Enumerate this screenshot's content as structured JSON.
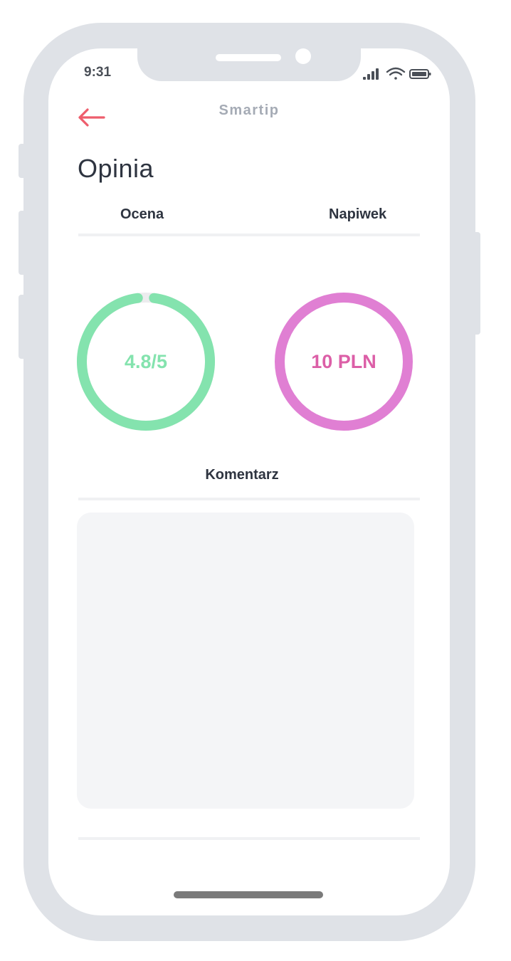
{
  "status_bar": {
    "time": "9:31"
  },
  "header": {
    "app_name": "Smartip",
    "back_icon": "arrow-left-icon"
  },
  "page": {
    "title": "Opinia"
  },
  "sections": {
    "rating_label": "Ocena",
    "tip_label": "Napiwek",
    "comment_label": "Komentarz"
  },
  "rating": {
    "display": "4.8/5",
    "value": 4.8,
    "max": 5,
    "color": "#84e3ae"
  },
  "tip": {
    "display": "10 PLN",
    "color": "#e07fd3",
    "text_color": "#dc5fa7"
  },
  "comment": {
    "value": ""
  },
  "colors": {
    "accent_back": "#ee5d6c",
    "frame": "#dfe2e7",
    "ring_track": "#ececee",
    "text_dark": "#2e3440",
    "text_muted": "#a5abb5"
  }
}
